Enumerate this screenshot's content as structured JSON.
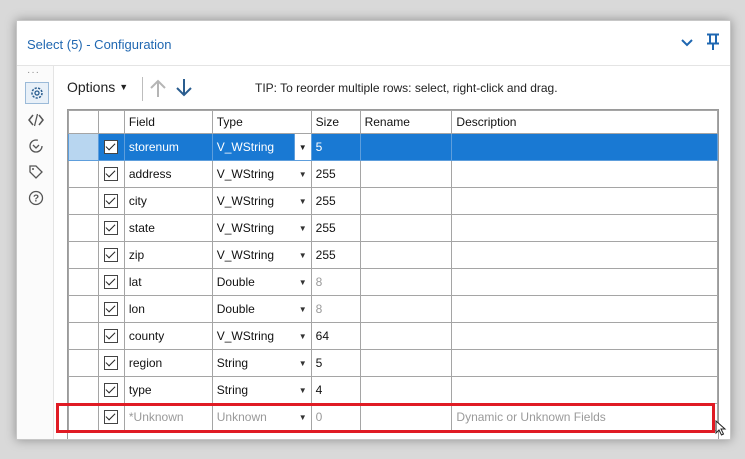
{
  "title": "Select (5) - Configuration",
  "toolbar": {
    "options_label": "Options",
    "tip": "TIP: To reorder multiple rows: select, right-click and drag."
  },
  "columns": [
    "Field",
    "Type",
    "Size",
    "Rename",
    "Description"
  ],
  "rows": [
    {
      "field": "storenum",
      "type": "V_WString",
      "size": "5",
      "rename": "",
      "description": "",
      "checked": true,
      "selected": true
    },
    {
      "field": "address",
      "type": "V_WString",
      "size": "255",
      "rename": "",
      "description": "",
      "checked": true
    },
    {
      "field": "city",
      "type": "V_WString",
      "size": "255",
      "rename": "",
      "description": "",
      "checked": true
    },
    {
      "field": "state",
      "type": "V_WString",
      "size": "255",
      "rename": "",
      "description": "",
      "checked": true
    },
    {
      "field": "zip",
      "type": "V_WString",
      "size": "255",
      "rename": "",
      "description": "",
      "checked": true
    },
    {
      "field": "lat",
      "type": "Double",
      "size": "8",
      "rename": "",
      "description": "",
      "checked": true,
      "size_dim": true
    },
    {
      "field": "lon",
      "type": "Double",
      "size": "8",
      "rename": "",
      "description": "",
      "checked": true,
      "size_dim": true
    },
    {
      "field": "county",
      "type": "V_WString",
      "size": "64",
      "rename": "",
      "description": "",
      "checked": true
    },
    {
      "field": "region",
      "type": "String",
      "size": "5",
      "rename": "",
      "description": "",
      "checked": true
    },
    {
      "field": "type",
      "type": "String",
      "size": "4",
      "rename": "",
      "description": "",
      "checked": true
    },
    {
      "field": "*Unknown",
      "type": "Unknown",
      "size": "0",
      "rename": "",
      "description": "Dynamic or Unknown Fields",
      "checked": true,
      "dim": true
    }
  ],
  "colors": {
    "accent": "#1f67b1",
    "selected_row": "#1979d3",
    "highlight_box": "#e01b24"
  },
  "icons": [
    "settings-icon",
    "xml-code-icon",
    "reload-icon",
    "tag-icon",
    "help-icon",
    "collapse-chevron-icon",
    "pin-icon",
    "arrow-up-icon",
    "arrow-down-icon"
  ]
}
